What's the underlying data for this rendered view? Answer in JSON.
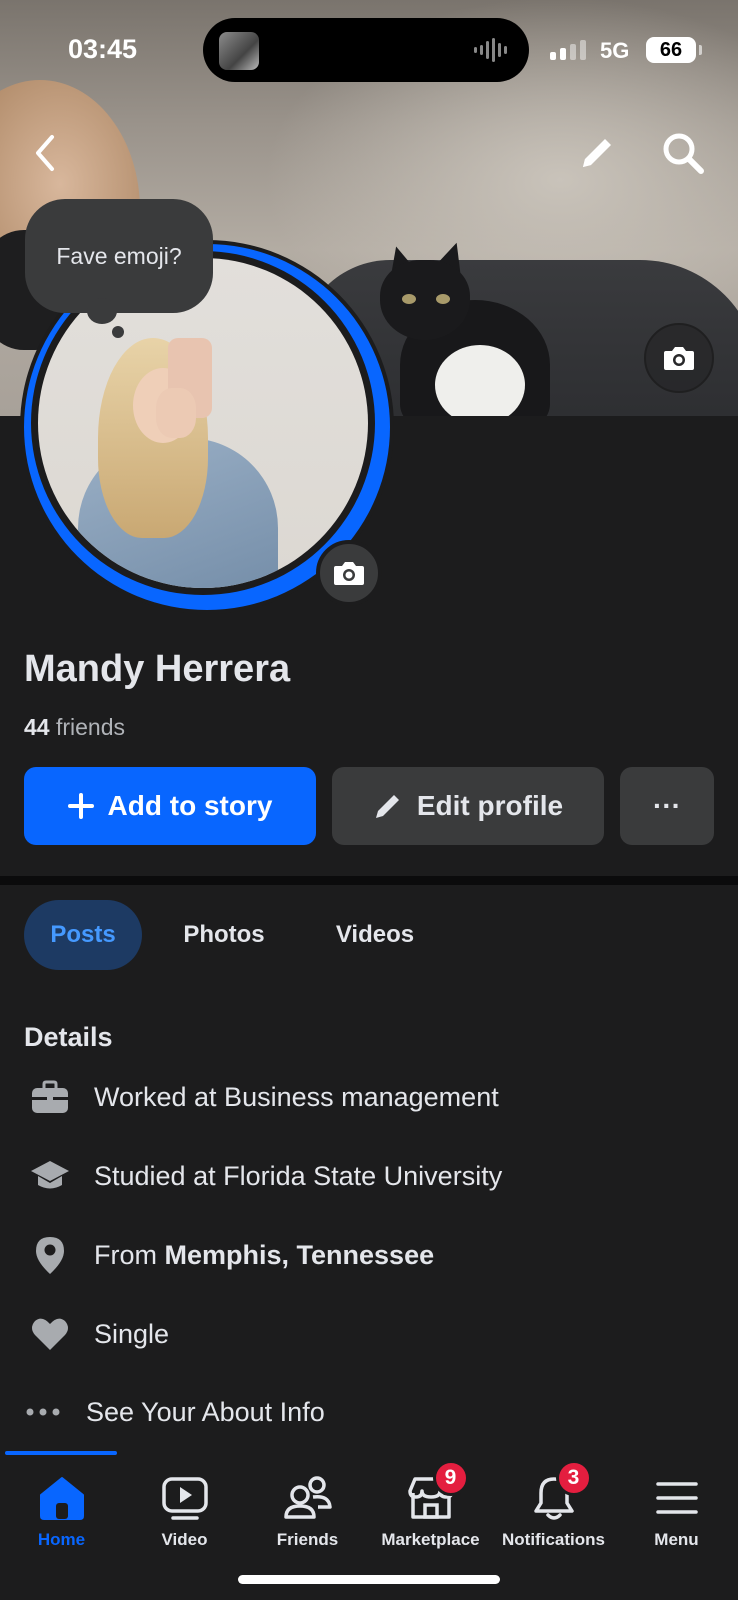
{
  "status_bar": {
    "time": "03:45",
    "network": "5G",
    "battery": "66"
  },
  "profile_note": {
    "text": "Fave emoji?"
  },
  "profile": {
    "name": "Mandy Herrera",
    "friends_count": "44",
    "friends_label": "friends"
  },
  "actions": {
    "add_story_label": "Add to story",
    "edit_profile_label": "Edit profile",
    "more_label": "···"
  },
  "tabs": [
    {
      "label": "Posts",
      "active": true
    },
    {
      "label": "Photos",
      "active": false
    },
    {
      "label": "Videos",
      "active": false
    }
  ],
  "details": {
    "title": "Details",
    "work": "Worked at Business management",
    "education": "Studied at Florida State University",
    "from_prefix": "From",
    "from_place": "Memphis, Tennessee",
    "relationship": "Single",
    "see_about": "See Your About Info"
  },
  "bottom_nav": [
    {
      "label": "Home",
      "icon": "home-icon",
      "active": true
    },
    {
      "label": "Video",
      "icon": "video-icon",
      "active": false
    },
    {
      "label": "Friends",
      "icon": "friends-icon",
      "active": false
    },
    {
      "label": "Marketplace",
      "icon": "marketplace-icon",
      "active": false,
      "badge": "9"
    },
    {
      "label": "Notifications",
      "icon": "bell-icon",
      "active": false,
      "badge": "3"
    },
    {
      "label": "Menu",
      "icon": "menu-icon",
      "active": false
    }
  ],
  "colors": {
    "accent": "#0866ff",
    "background": "#1c1c1d",
    "badge": "#e41e3f",
    "active_tab_bg": "#1d3a63"
  }
}
